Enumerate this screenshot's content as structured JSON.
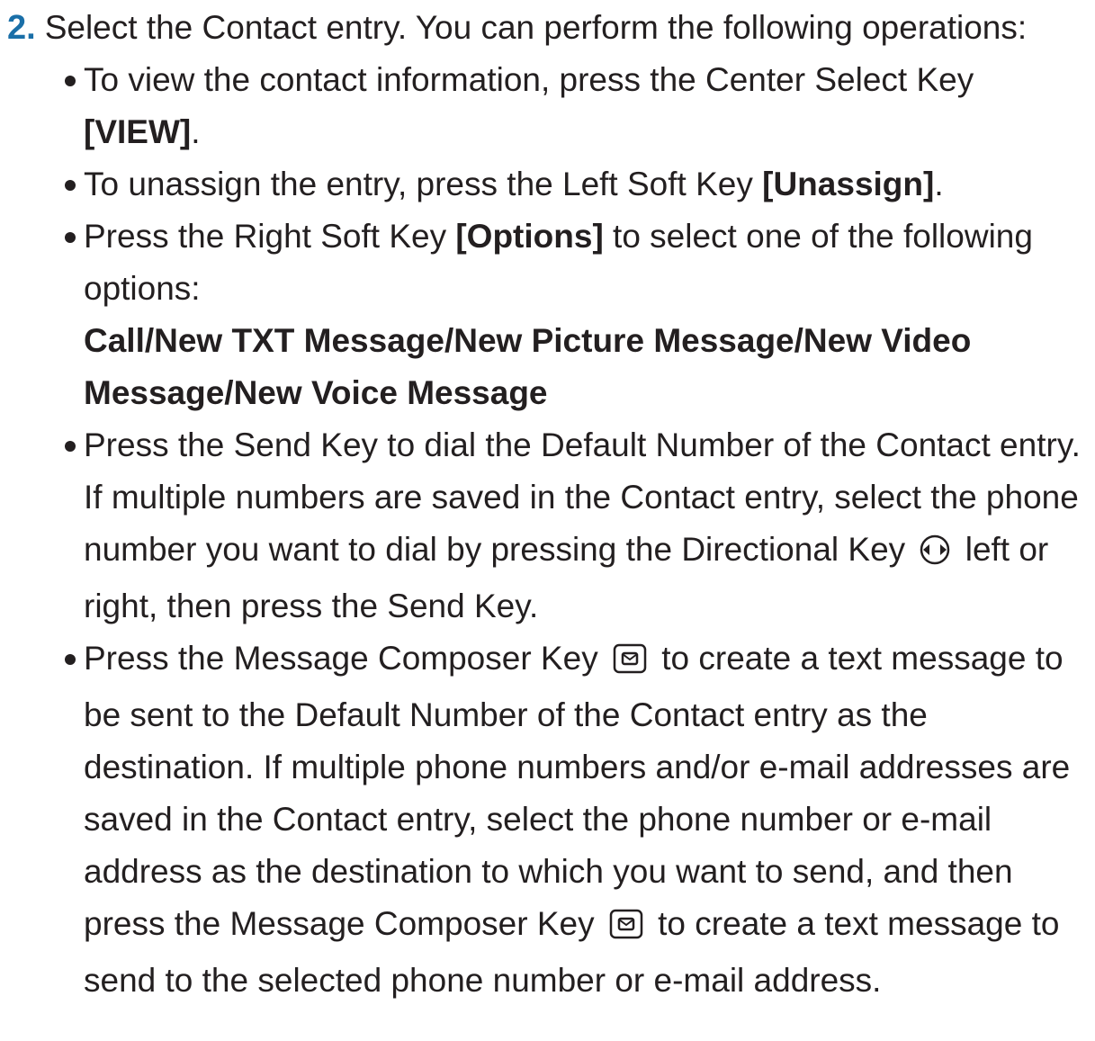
{
  "step": {
    "number": "2.",
    "intro": "Select the Contact entry. You can perform the following operations:"
  },
  "bullets": [
    {
      "before": "To view the contact information, press the Center Select Key ",
      "bold": "[VIEW]",
      "after": "."
    },
    {
      "before": "To unassign the entry, press the Left Soft Key ",
      "bold": "[Unassign]",
      "after": "."
    },
    {
      "before": "Press the Right Soft Key ",
      "bold": "[Options]",
      "after": " to select one of the following options:"
    },
    {
      "text_1": "Press the Send Key to dial the Default Number of the Contact entry. If multiple numbers are saved in the Contact entry, select the phone number you want to dial by pressing the Directional Key ",
      "icon": "directional-key-icon",
      "text_2": " left or right, then press the Send Key."
    },
    {
      "text_1": "Press the Message Composer Key ",
      "icon": "message-composer-key-icon",
      "text_2": " to create a text message to be sent to the Default Number of the Contact entry as the destination. If multiple phone numbers and/or e-mail addresses are saved in the Contact entry, select the phone number or e-mail address as the destination to which you want to send, and then press the Message Composer Key ",
      "text_3": " to create a text message to send to the selected phone number or e-mail address."
    }
  ],
  "options_list": "Call/New TXT Message/New Picture Message/New Video Message/New Voice Message"
}
